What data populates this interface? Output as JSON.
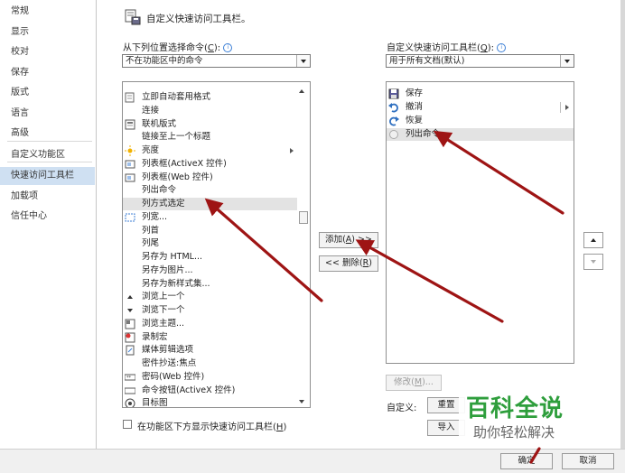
{
  "nav": {
    "items": [
      "常规",
      "显示",
      "校对",
      "保存",
      "版式",
      "语言",
      "高级",
      "自定义功能区",
      "快速访问工具栏",
      "加载项",
      "信任中心"
    ],
    "selected": "快速访问工具栏"
  },
  "header": {
    "title": "自定义快速访问工具栏。"
  },
  "left": {
    "choose_label": "从下列位置选择命令(",
    "choose_key": "C",
    "choose_tail": "):",
    "choose_value": "不在功能区中的命令",
    "commands": [
      {
        "icon": "format-icon",
        "text": "立即自动套用格式"
      },
      {
        "icon": "blank-icon",
        "text": "连接"
      },
      {
        "icon": "online-layout-icon",
        "text": "联机版式"
      },
      {
        "icon": "blank-icon",
        "text": "链接至上一个标题"
      },
      {
        "icon": "brightness-icon",
        "text": "亮度"
      },
      {
        "icon": "listbox-activex-icon",
        "text": "列表框(ActiveX 控件)"
      },
      {
        "icon": "listbox-web-icon",
        "text": "列表框(Web 控件)"
      },
      {
        "icon": "blank-icon",
        "text": "列出命令"
      },
      {
        "icon": "blank-icon",
        "text": "列方式选定"
      },
      {
        "icon": "column-width-icon",
        "text": "列宽..."
      },
      {
        "icon": "blank-icon",
        "text": "列首"
      },
      {
        "icon": "blank-icon",
        "text": "列尾"
      },
      {
        "icon": "blank-icon",
        "text": "另存为 HTML..."
      },
      {
        "icon": "blank-icon",
        "text": "另存为图片..."
      },
      {
        "icon": "blank-icon",
        "text": "另存为新样式集..."
      },
      {
        "icon": "browse-prev-icon",
        "text": "浏览上一个"
      },
      {
        "icon": "browse-next-icon",
        "text": "浏览下一个"
      },
      {
        "icon": "browse-theme-icon",
        "text": "浏览主题..."
      },
      {
        "icon": "record-macro-icon",
        "text": "录制宏"
      },
      {
        "icon": "clip-options-icon",
        "text": "媒体剪辑选项"
      },
      {
        "icon": "blank-icon",
        "text": "密件抄送:焦点"
      },
      {
        "icon": "password-web-icon",
        "text": "密码(Web 控件)"
      },
      {
        "icon": "command-button-icon",
        "text": "命令按钮(ActiveX 控件)"
      },
      {
        "icon": "target-icon",
        "text": "目标图"
      }
    ],
    "show_below_label": "在功能区下方显示快速访问工具栏(",
    "show_below_key": "H",
    "show_below_tail": ")"
  },
  "right": {
    "qat_label": "自定义快速访问工具栏(",
    "qat_key": "Q",
    "qat_tail": "):",
    "qat_value": "用于所有文档(默认)",
    "items": [
      {
        "icon": "save-icon",
        "text": "保存"
      },
      {
        "icon": "undo-icon",
        "text": "撤消"
      },
      {
        "icon": "redo-icon",
        "text": "恢复"
      },
      {
        "icon": "list-commands-icon",
        "text": "列出命令"
      }
    ],
    "modify_label": "修改(",
    "modify_key": "M",
    "modify_tail": ")...",
    "customize_label": "自定义:",
    "reset_label": "重置",
    "import_label": "导入"
  },
  "middle": {
    "add_label": "添加(",
    "add_key": "A",
    "add_tail": ") >>",
    "remove_prefix": "<< 删除(",
    "remove_key": "R",
    "remove_tail": ")"
  },
  "footer": {
    "ok_label": "确定",
    "cancel_label": "取消"
  },
  "watermark": {
    "main": "百科全说",
    "sub": "助你轻松解决"
  },
  "colors": {
    "arrow": "#9e1414",
    "selection": "#cfe0f2",
    "highlight": "#e3e3e3",
    "watermark_green": "#2e9e3c"
  }
}
